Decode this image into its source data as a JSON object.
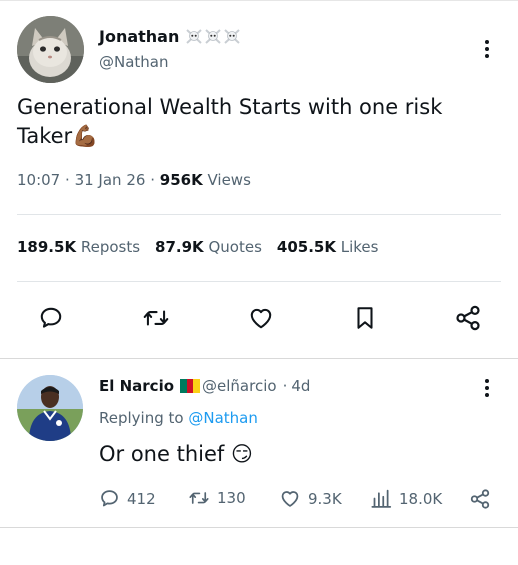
{
  "tweet": {
    "author": {
      "name": "Jonathan",
      "handle": "@Nathan",
      "badge_emoji": "☠️☠️☠️"
    },
    "text": "Generational Wealth Starts with one risk Taker",
    "text_emoji": "💪🏾",
    "meta": {
      "time": "10:07",
      "date": "31 Jan 26",
      "views_count": "956K",
      "views_label": "Views",
      "separator": "·"
    },
    "stats": {
      "reposts": {
        "count": "189.5K",
        "label": "Reposts"
      },
      "quotes": {
        "count": "87.9K",
        "label": "Quotes"
      },
      "likes": {
        "count": "405.5K",
        "label": "Likes"
      }
    },
    "actions": [
      "reply-icon",
      "retweet-icon",
      "heart-icon",
      "bookmark-icon",
      "share-icon"
    ]
  },
  "reply": {
    "author": {
      "name": "El Narcio",
      "handle": "@elñarcio",
      "flag": "Cameroon"
    },
    "separator": "·",
    "time": "4d",
    "replying_prefix": "Replying to",
    "replying_to": "@Nathan",
    "text": "Or one thief",
    "text_emoji": "😏",
    "actions": {
      "replies": "412",
      "reposts": "130",
      "likes": "9.3K",
      "views": "18.0K"
    }
  },
  "colors": {
    "text": "#0f1419",
    "secondary": "#536471",
    "link": "#1d9bf0",
    "divider": "#e1e5e8"
  }
}
